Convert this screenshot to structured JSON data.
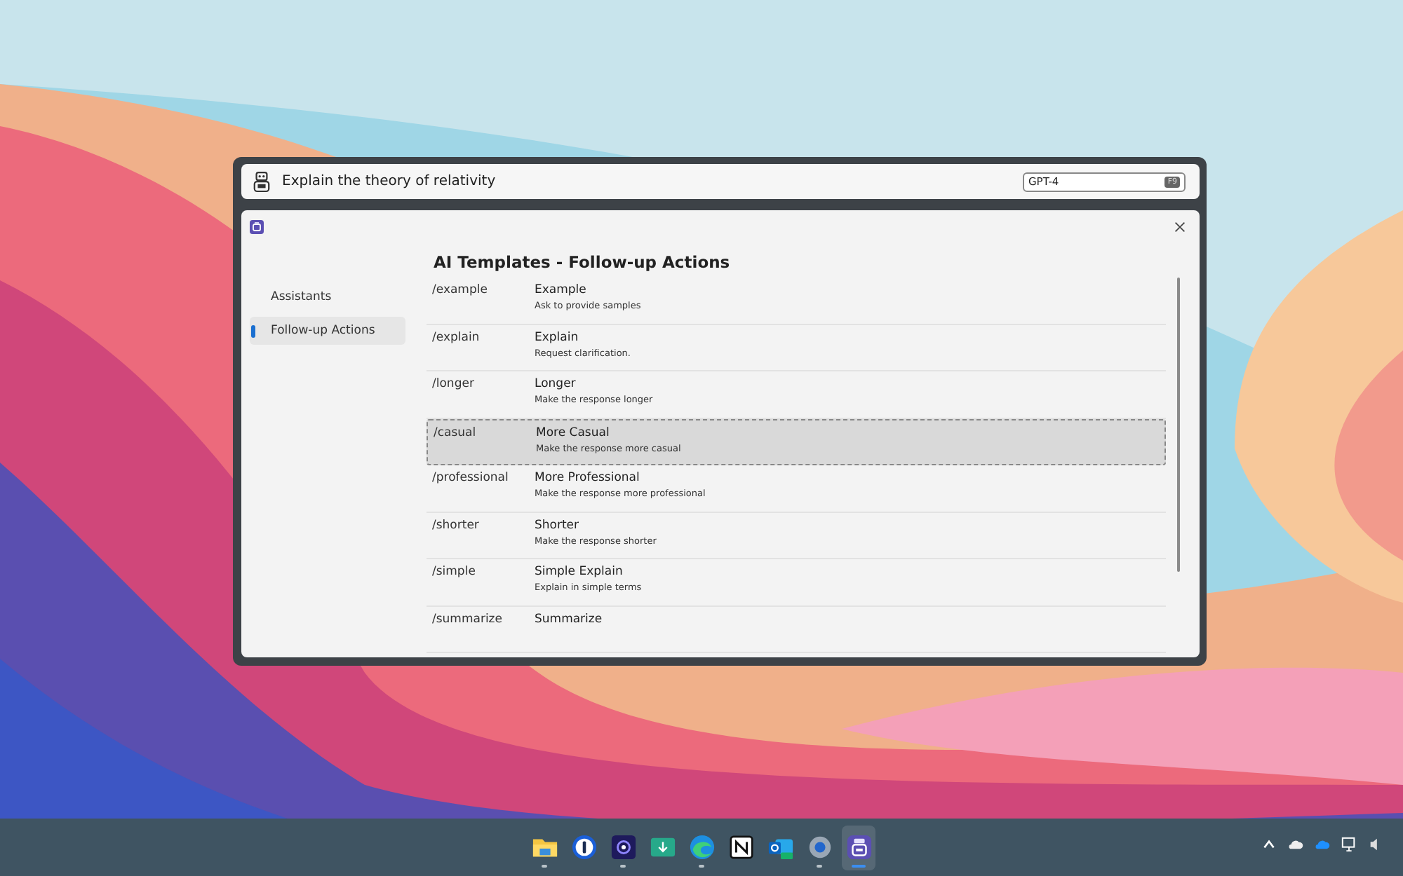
{
  "prompt": {
    "value": "Explain the theory of relativity"
  },
  "model_field": {
    "value": "GPT-4",
    "shortcut": "F9"
  },
  "panel": {
    "title": "AI Templates - Follow-up Actions"
  },
  "sidebar": {
    "items": [
      {
        "label": "Assistants",
        "selected": false
      },
      {
        "label": "Follow-up Actions",
        "selected": true
      }
    ]
  },
  "templates": [
    {
      "command": "/example",
      "title": "Example",
      "description": "Ask to provide samples",
      "selected": false
    },
    {
      "command": "/explain",
      "title": "Explain",
      "description": "Request clarification.",
      "selected": false
    },
    {
      "command": "/longer",
      "title": "Longer",
      "description": "Make the response longer",
      "selected": false
    },
    {
      "command": "/casual",
      "title": "More Casual",
      "description": "Make the response more casual",
      "selected": true
    },
    {
      "command": "/professional",
      "title": "More Professional",
      "description": "Make the response more professional",
      "selected": false
    },
    {
      "command": "/shorter",
      "title": "Shorter",
      "description": "Make the response shorter",
      "selected": false
    },
    {
      "command": "/simple",
      "title": "Simple Explain",
      "description": "Explain in simple terms",
      "selected": false
    },
    {
      "command": "/summarize",
      "title": "Summarize",
      "selected": false
    }
  ],
  "taskbar": {
    "apps": [
      {
        "kind": "folder",
        "running": true,
        "selected": false
      },
      {
        "kind": "password",
        "running": false,
        "selected": false
      },
      {
        "kind": "record",
        "running": true,
        "selected": false
      },
      {
        "kind": "download",
        "running": false,
        "selected": false
      },
      {
        "kind": "browser",
        "running": true,
        "selected": false
      },
      {
        "kind": "notes",
        "running": false,
        "selected": false
      },
      {
        "kind": "mail",
        "running": false,
        "selected": false
      },
      {
        "kind": "gear",
        "running": true,
        "selected": false
      },
      {
        "kind": "robot",
        "running": true,
        "selected": true
      }
    ]
  }
}
